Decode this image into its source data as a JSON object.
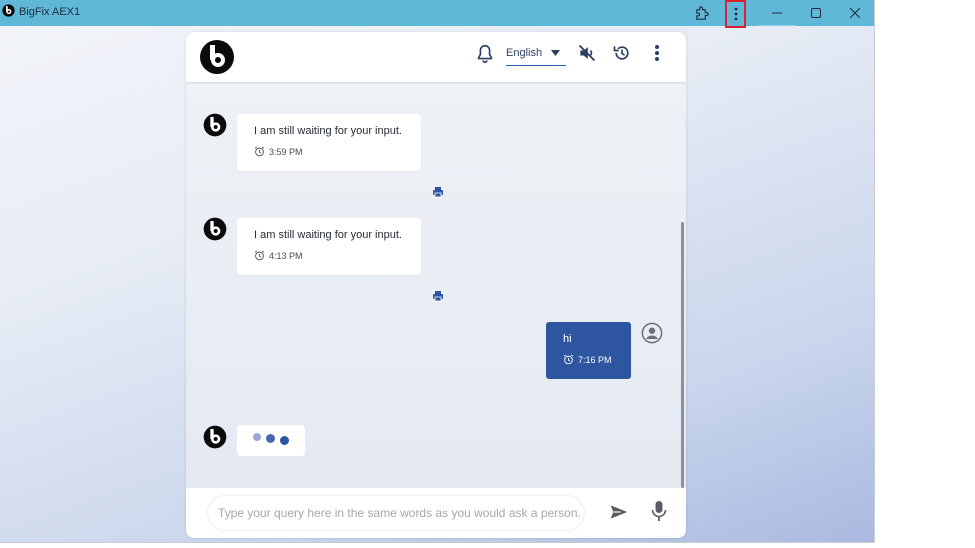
{
  "window": {
    "title": "BigFix AEX1",
    "logo_icon": "bigfix-logo-icon",
    "controls": [
      "extensions-icon",
      "more-vertical-icon",
      "minimize-icon",
      "maximize-icon",
      "close-icon"
    ]
  },
  "header": {
    "language": "English",
    "icons": [
      "bell-icon",
      "mute-icon",
      "history-icon",
      "more-vertical-icon"
    ]
  },
  "messages": [
    {
      "from": "bot",
      "text": "I am still waiting for your input.",
      "time": "3:59 PM"
    },
    {
      "from": "bot",
      "text": "I am still waiting for your input.",
      "time": "4:13 PM"
    },
    {
      "from": "user",
      "text": "hi",
      "time": "7:16 PM"
    }
  ],
  "composer": {
    "placeholder": "Type your query here in the same words as you would ask a person."
  },
  "colors": {
    "titlebar": "#5fb8d8",
    "user_bubble": "#2e56a0",
    "highlight_box": "#d9232e"
  }
}
